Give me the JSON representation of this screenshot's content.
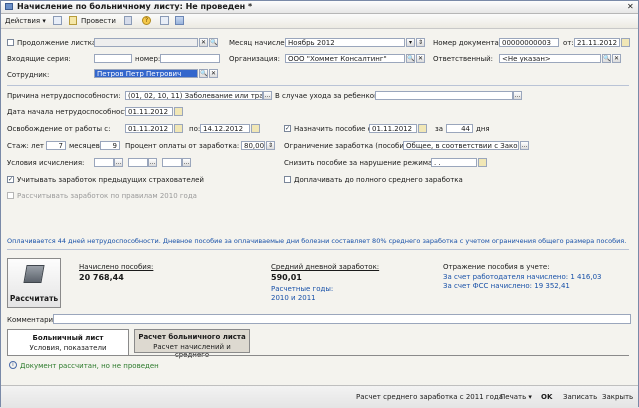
{
  "window": {
    "title": "Начисление по больничному листу: Не проведен *"
  },
  "toolbar": {
    "actions_label": "Действия",
    "post_label": "Провести",
    "icons": [
      "document-icon",
      "refresh-icon",
      "post-icon",
      "copy-icon",
      "help-icon",
      "calendar-icon",
      "structure-icon"
    ]
  },
  "form": {
    "continuation_label": "Продолжение листка",
    "incoming_series_label": "Входящие серия:",
    "incoming_number_label": "номер:",
    "employee_label": "Сотрудник:",
    "employee_value": "Петров Петр Петрович",
    "accrual_month_label": "Месяц начисления:",
    "accrual_month_value": "Ноябрь 2012",
    "organization_label": "Организация:",
    "organization_value": "ООО \"Хоммет Консалтинг\"",
    "doc_number_label": "Номер документа:",
    "doc_number_value": "00000000003",
    "doc_date_label": "от:",
    "doc_date_value": "21.11.2012",
    "responsible_label": "Ответственный:",
    "responsible_value": "<Не указан>",
    "disability_reason_label": "Причина нетрудоспособности:",
    "disability_reason_value": "(01, 02, 10, 11) Заболевание или травма",
    "childcare_label": "В случае ухода за ребенком:",
    "start_date_label": "Дата начала нетрудоспособности:",
    "start_date_value": "01.11.2012",
    "release_from_label": "Освобождение от работы с:",
    "release_from_value": "01.11.2012",
    "release_to_label": "по:",
    "release_to_value": "14.12.2012",
    "assign_benefit_label": "Назначить пособие с:",
    "assign_benefit_value": "01.11.2012",
    "days_label_pre": "за",
    "days_value": "44",
    "days_label_post": "дня",
    "experience_label": "Стаж: лет",
    "experience_years": "7",
    "months_label": "месяцев",
    "experience_months": "9",
    "pay_percent_label": "Процент оплаты от заработка:",
    "pay_percent_value": "80,00",
    "earnings_limit_label": "Ограничение заработка (пособия):",
    "earnings_limit_value": "Общее, в соответствии с Закон",
    "calc_conditions_label": "Условия исчисления:",
    "reduce_benefit_label": "Снизить пособие за нарушение режима с:",
    "reduce_benefit_value": ". .",
    "prev_employers_label": "Учитывать заработок предыдущих страхователей",
    "topup_label": "Доплачивать до полного среднего заработка",
    "rules2010_label": "Рассчитывать заработок по правилам 2010 года"
  },
  "info_text": "Оплачивается 44 дней нетрудоспособности. Дневное пособие за оплачиваемые дни болезни составляет 80% среднего заработка с учетом ограничения общего размера пособия.",
  "calc": {
    "button_label": "Рассчитать",
    "accrued_label": "Начислено пособия:",
    "accrued_value": "20 768,44",
    "avg_daily_label": "Средний дневной заработок:",
    "avg_daily_value": "590,01",
    "years_label": "Расчетные годы:",
    "years_value": "2010 и 2011",
    "reflection_label": "Отражение пособия в учете:",
    "employer_line": "За счет работодателя начислено: 1 416,03",
    "fss_line": "За счет ФСС начислено: 19 352,41"
  },
  "comment": {
    "label": "Комментарий:",
    "value": ""
  },
  "tabs": [
    {
      "title": "Больничный лист",
      "subtitle": "Условия, показатели"
    },
    {
      "title": "Расчет больничного листа",
      "subtitle": "Расчет начислений и среднего"
    }
  ],
  "status_message": "Документ рассчитан, но не проведен",
  "bottom": {
    "avg_earnings_btn": "Расчет среднего заработка с 2011 года",
    "print_btn": "Печать",
    "ok_btn": "OK",
    "save_btn": "Записать",
    "close_btn": "Закрыть"
  }
}
